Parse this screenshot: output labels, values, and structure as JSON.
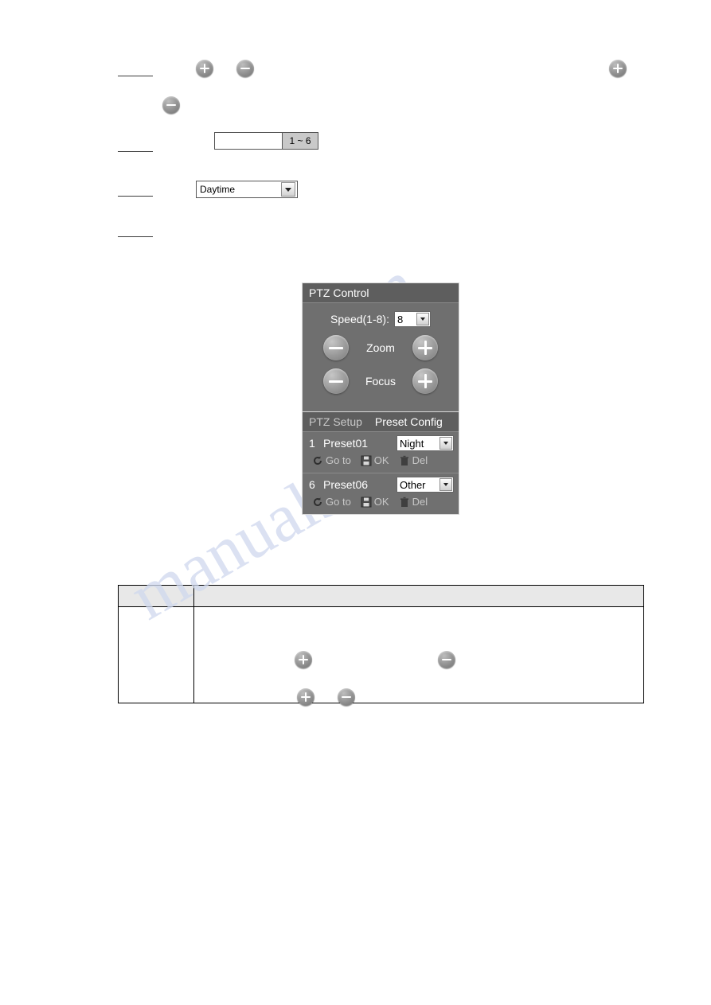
{
  "page": {
    "watermark_line1": ".com",
    "watermark_line2": "manualshive"
  },
  "ptz": {
    "control_title": "PTZ Control",
    "speed_label": "Speed(1-8):",
    "speed_value": "8",
    "zoom_label": "Zoom",
    "focus_label": "Focus",
    "zoom_out_icon": "minus-circle-icon",
    "zoom_in_icon": "plus-circle-icon",
    "focus_out_icon": "minus-circle-icon",
    "focus_in_icon": "plus-circle-icon",
    "tabs": [
      {
        "label": "PTZ Setup",
        "active": false
      },
      {
        "label": "Preset Config",
        "active": true
      }
    ],
    "presets": [
      {
        "index": "1",
        "name": "Preset01",
        "mode": "Night",
        "goto_label": "Go to",
        "ok_label": "OK",
        "del_label": "Del"
      },
      {
        "index": "6",
        "name": "Preset06",
        "mode": "Other",
        "goto_label": "Go to",
        "ok_label": "OK",
        "del_label": "Del"
      }
    ]
  },
  "inputs": {
    "range_value": "",
    "range_suffix": "1 ~ 6",
    "daytime_value": "Daytime"
  },
  "icons": {
    "plus_top_left": "plus-circle-icon",
    "minus_top_left": "minus-circle-icon",
    "plus_top_right": "plus-circle-icon",
    "minus_second_row": "minus-circle-icon",
    "table_plus_1": "plus-circle-icon",
    "table_minus_1": "minus-circle-icon",
    "table_plus_2": "plus-circle-icon",
    "table_minus_2": "minus-circle-icon"
  }
}
